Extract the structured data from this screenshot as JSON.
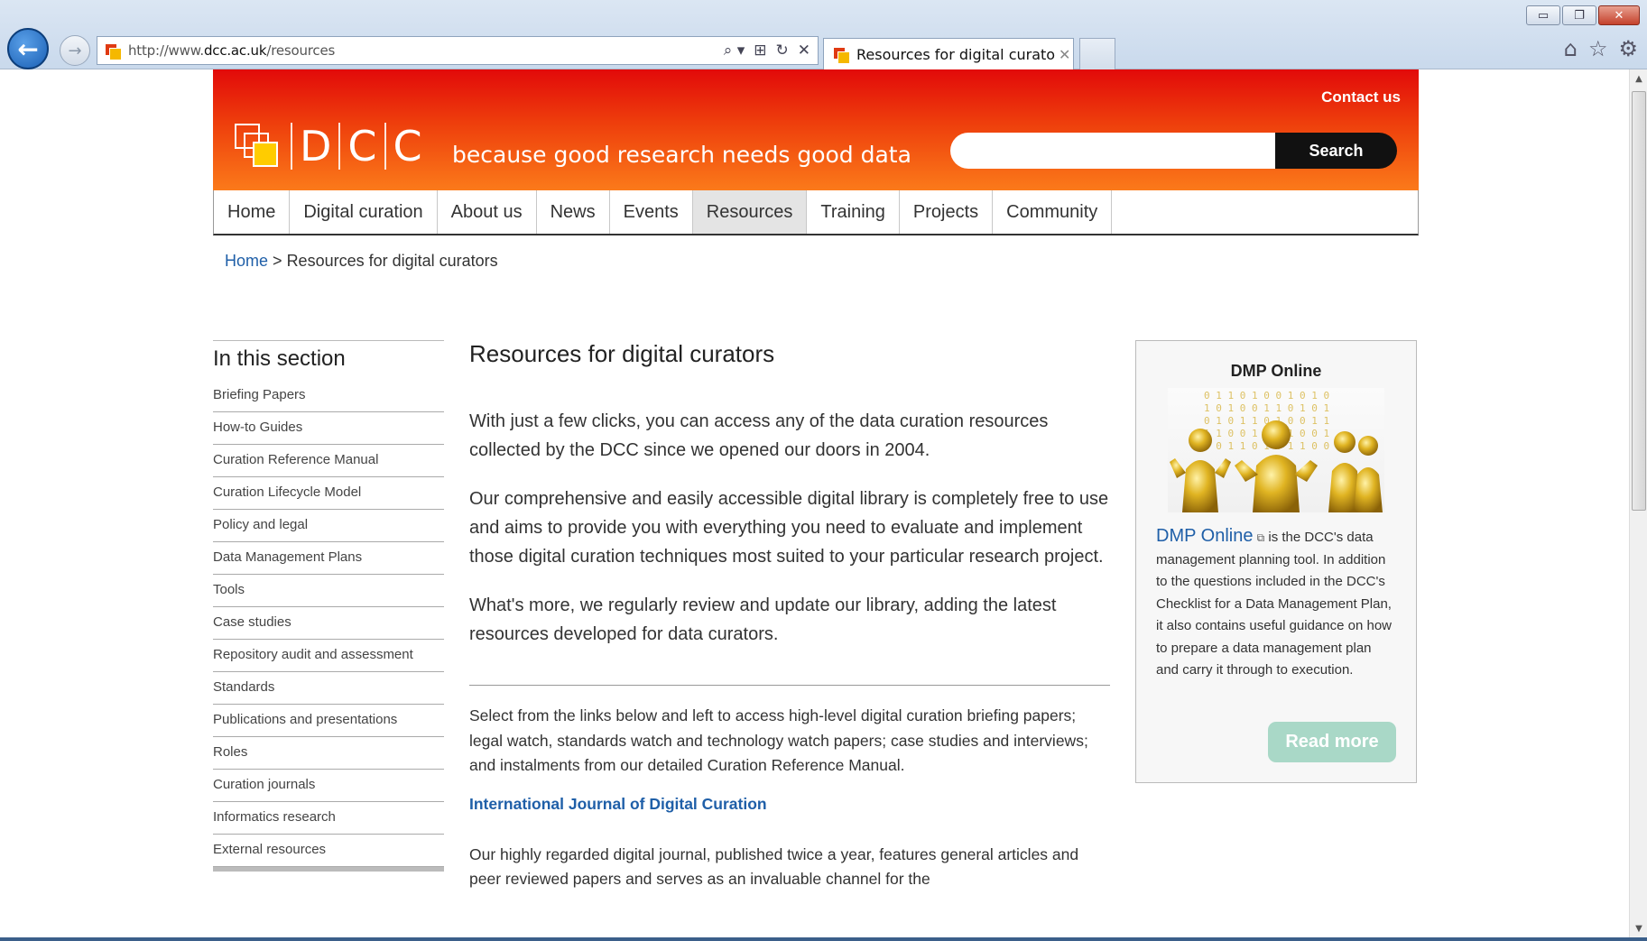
{
  "browser": {
    "url_prefix": "http://www.",
    "url_domain": "dcc.ac.uk",
    "url_path": "/resources",
    "tab_title": "Resources for digital curato...",
    "tab_close": "✕",
    "back_glyph": "←",
    "forward_glyph": "→",
    "address_tools": [
      "⌕ ▾",
      "⊞",
      "↻",
      "✕"
    ],
    "right_icons": [
      "⌂",
      "☆",
      "⚙"
    ],
    "window_controls": [
      "▭",
      "❐",
      "✕"
    ]
  },
  "site": {
    "contact": "Contact us",
    "logo_letters": [
      "D",
      "C",
      "C"
    ],
    "tagline": "because good research needs good data",
    "search": {
      "placeholder": "",
      "button": "Search"
    },
    "nav": [
      "Home",
      "Digital curation",
      "About us",
      "News",
      "Events",
      "Resources",
      "Training",
      "Projects",
      "Community"
    ],
    "nav_active": "Resources",
    "breadcrumb": {
      "home": "Home",
      "separator": ">",
      "current": "Resources for digital curators"
    },
    "sidebar": {
      "title": "In this section",
      "items": [
        "Briefing Papers",
        "How-to Guides",
        "Curation Reference Manual",
        "Curation Lifecycle Model",
        "Policy and legal",
        "Data Management Plans",
        "Tools",
        "Case studies",
        "Repository audit and assessment",
        "Standards",
        "Publications and presentations",
        "Roles",
        "Curation journals",
        "Informatics research",
        "External resources"
      ]
    },
    "main": {
      "title": "Resources for digital curators",
      "lead": [
        "With just a few clicks, you can access any of the data curation resources collected by the DCC since we opened our doors in 2004.",
        "Our comprehensive and easily accessible digital library is completely free to use and aims to provide you with everything you need to evaluate and implement those digital curation techniques most suited to your particular research project.",
        "What's more, we regularly review and update our library, adding the latest resources developed for data curators."
      ],
      "intro": "Select from the links below and left to access high-level digital curation briefing papers; legal watch, standards watch and technology watch papers; case studies and interviews; and instalments from our detailed Curation Reference Manual.",
      "ijdc_link": "International Journal of Digital Curation",
      "ijdc_text": "Our highly regarded digital journal, published twice a year, features general articles and peer reviewed papers and serves as an invaluable channel for the"
    },
    "dmp": {
      "title": "DMP Online",
      "link": "DMP Online",
      "ext_icon": "⧉",
      "text": "is the DCC's data management planning tool. In addition to the questions included in the DCC's Checklist for a Data Management Plan, it also contains useful guidance on how to prepare a data management plan and carry it through to execution.",
      "read_more": "Read more",
      "image_alt_digits": "0101 1001 0110 1010 0011 1100"
    },
    "colors": {
      "brand_red": "#e20a0a",
      "brand_orange": "#fb7a1a",
      "link": "#1f5fa8",
      "read_more": "#a9d8c7"
    }
  }
}
